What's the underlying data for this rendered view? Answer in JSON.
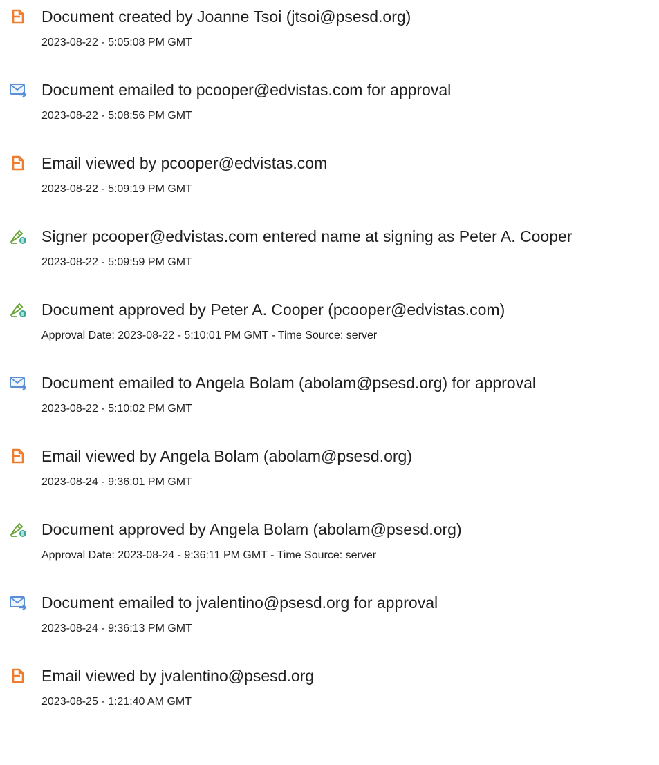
{
  "events": [
    {
      "type": "document-icon",
      "title": "Document created by Joanne Tsoi (jtsoi@psesd.org)",
      "timestamp": "2023-08-22 - 5:05:08 PM GMT"
    },
    {
      "type": "email-icon",
      "title": "Document emailed to pcooper@edvistas.com for approval",
      "timestamp": "2023-08-22 - 5:08:56 PM GMT"
    },
    {
      "type": "document-icon",
      "title": "Email viewed by pcooper@edvistas.com",
      "timestamp": "2023-08-22 - 5:09:19 PM GMT"
    },
    {
      "type": "signature-icon",
      "title": "Signer pcooper@edvistas.com entered name at signing as Peter A. Cooper",
      "timestamp": "2023-08-22 - 5:09:59 PM GMT"
    },
    {
      "type": "signature-icon",
      "title": "Document approved by Peter A. Cooper (pcooper@edvistas.com)",
      "timestamp": "Approval Date: 2023-08-22 - 5:10:01 PM GMT - Time Source: server"
    },
    {
      "type": "email-icon",
      "title": "Document emailed to Angela Bolam (abolam@psesd.org) for approval",
      "timestamp": "2023-08-22 - 5:10:02 PM GMT"
    },
    {
      "type": "document-icon",
      "title": "Email viewed by Angela Bolam (abolam@psesd.org)",
      "timestamp": "2023-08-24 - 9:36:01 PM GMT"
    },
    {
      "type": "signature-icon",
      "title": "Document approved by Angela Bolam (abolam@psesd.org)",
      "timestamp": "Approval Date: 2023-08-24 - 9:36:11 PM GMT - Time Source: server"
    },
    {
      "type": "email-icon",
      "title": "Document emailed to jvalentino@psesd.org for approval",
      "timestamp": "2023-08-24 - 9:36:13 PM GMT"
    },
    {
      "type": "document-icon",
      "title": "Email viewed by jvalentino@psesd.org",
      "timestamp": "2023-08-25 - 1:21:40 AM GMT"
    }
  ],
  "colors": {
    "document_icon": "#f07c2e",
    "email_icon": "#5a8fd6",
    "signature_icon": "#3aa79a",
    "text": "#1f1f1f"
  }
}
